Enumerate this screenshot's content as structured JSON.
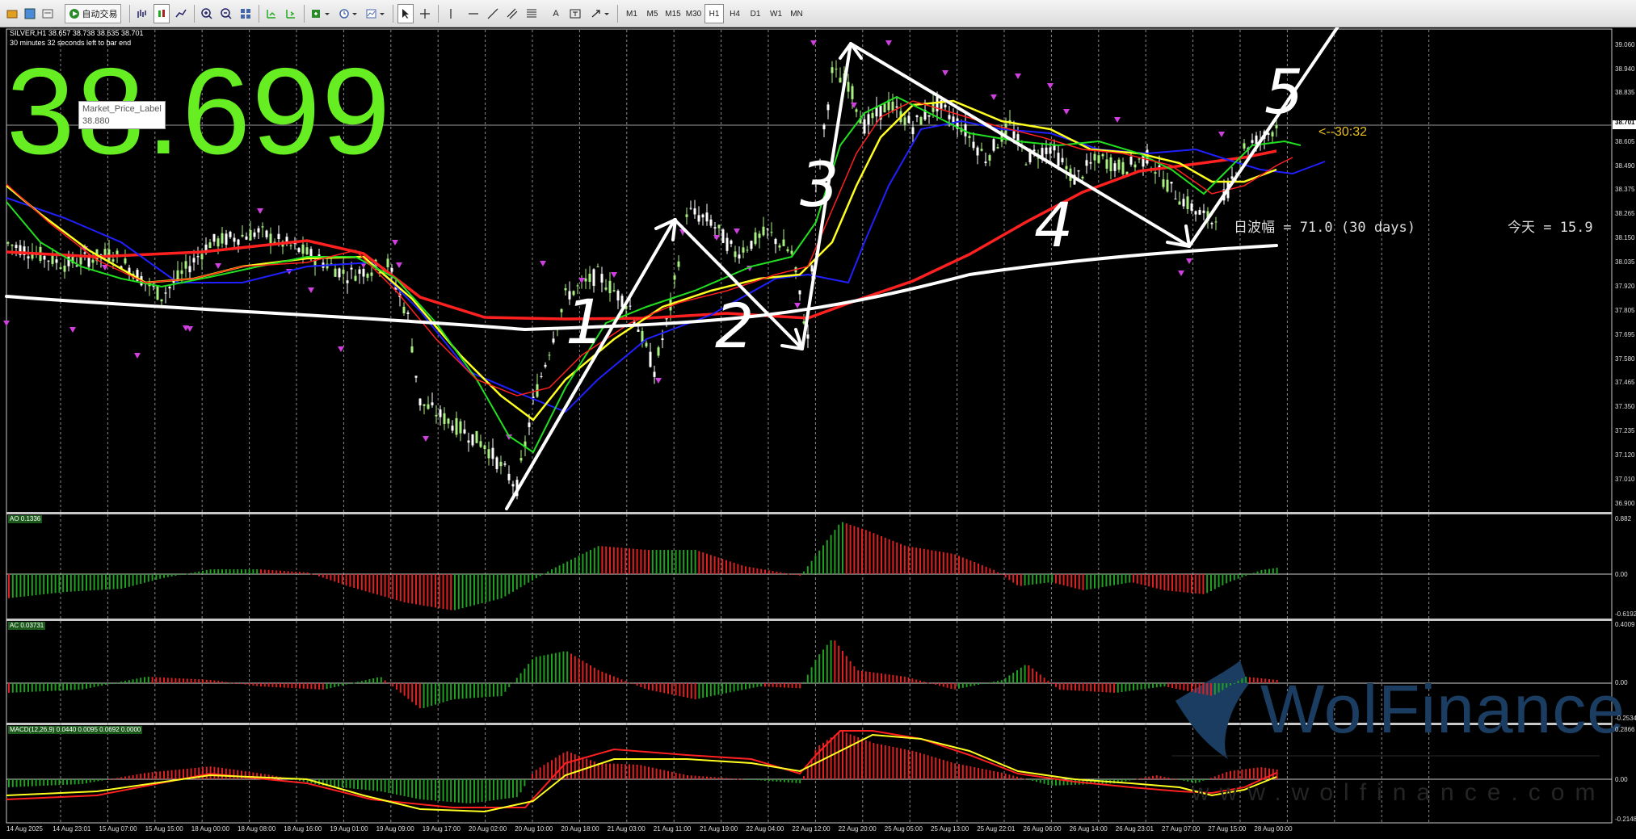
{
  "toolbar": {
    "auto_trading_label": "自动交易",
    "timeframes": [
      "M1",
      "M5",
      "M15",
      "M30",
      "H1",
      "H4",
      "D1",
      "W1",
      "MN"
    ],
    "active_timeframe": "H1"
  },
  "chart": {
    "symbol_line": "SILVER,H1  38.657 38.738 38.635 38.701",
    "countdown_note": "30 minutes 32 seconds left to bar end",
    "big_price": "38.699",
    "market_price_label": {
      "title": "Market_Price_Label",
      "value": "38.880"
    },
    "candle_countdown": "<--30:32",
    "daily_range": "日波幅 = 71.0  (30 days)",
    "today_range": "今天 = 15.9",
    "wave_labels": [
      "1",
      "2",
      "3",
      "4",
      "5"
    ],
    "price_axis": [
      "39.060",
      "38.940",
      "38.835",
      "38.701",
      "38.605",
      "38.490",
      "38.375",
      "38.265",
      "38.150",
      "38.035",
      "37.920",
      "37.805",
      "37.695",
      "37.580",
      "37.465",
      "37.350",
      "37.235",
      "37.120",
      "37.010",
      "36.900"
    ],
    "current_price_tag": "38.701",
    "time_axis": [
      "14 Aug 2025",
      "14 Aug 23:01",
      "15 Aug 07:00",
      "15 Aug 15:00",
      "18 Aug 00:00",
      "18 Aug 08:00",
      "18 Aug 16:00",
      "19 Aug 01:00",
      "19 Aug 09:00",
      "19 Aug 17:00",
      "20 Aug 02:00",
      "20 Aug 10:00",
      "20 Aug 18:00",
      "21 Aug 03:00",
      "21 Aug 11:00",
      "21 Aug 19:00",
      "22 Aug 04:00",
      "22 Aug 12:00",
      "22 Aug 20:00",
      "25 Aug 05:00",
      "25 Aug 13:00",
      "25 Aug 22:01",
      "26 Aug 06:00",
      "26 Aug 14:00",
      "26 Aug 23:01",
      "27 Aug 07:00",
      "27 Aug 15:00",
      "28 Aug 00:00"
    ]
  },
  "indicators": {
    "ao": {
      "label": "AO 0.1336",
      "axis": [
        "0.882",
        "0.00",
        "-0.6192"
      ]
    },
    "ac": {
      "label": "AC 0.03731",
      "axis": [
        "0.4009",
        "0.00",
        "-0.2534"
      ]
    },
    "macd": {
      "label": "MACD(12,26,9) 0.0440 0.0095 0.0692 0.0000",
      "axis": [
        "0.2866",
        "0.00",
        "-0.2148"
      ]
    }
  },
  "watermark": {
    "brand": "WolFinance",
    "url": "www.wolfinance.com"
  },
  "colors": {
    "bull": "#a8f080",
    "bear": "#ffffff",
    "ma_red": "#ff2020",
    "ma_blue": "#2020ff",
    "ma_yellow": "#ffff20",
    "ma_green": "#20e020",
    "hist_up": "#20a020",
    "hist_down": "#e02020",
    "big_price": "#66ee22"
  }
}
